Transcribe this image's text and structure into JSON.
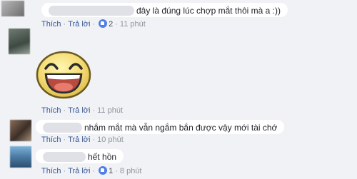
{
  "comments": [
    {
      "text": "đây là đúng lúc chợp mắt thôi mà a :))",
      "actions": {
        "like": "Thích",
        "reply": "Trả lời",
        "like_count": "2",
        "time": "11 phút"
      }
    },
    {
      "sticker": "grinning-face-sticker",
      "actions": {
        "like": "Thích",
        "reply": "Trả lời",
        "time": "11 phút"
      }
    },
    {
      "text": "nhắm mắt mà vẫn ngắm bắn được vậy mới tài chớ",
      "actions": {
        "like": "Thích",
        "reply": "Trả lời",
        "time": "10 phút"
      }
    },
    {
      "text": "hết hồn",
      "actions": {
        "like": "Thích",
        "reply": "Trả lời",
        "like_count": "1",
        "time": "8 phút"
      }
    }
  ],
  "separator": "·",
  "colors": {
    "link": "#385898",
    "meta": "#90949c",
    "like_badge": "#4f7ee8",
    "background": "#f1f2f5"
  }
}
